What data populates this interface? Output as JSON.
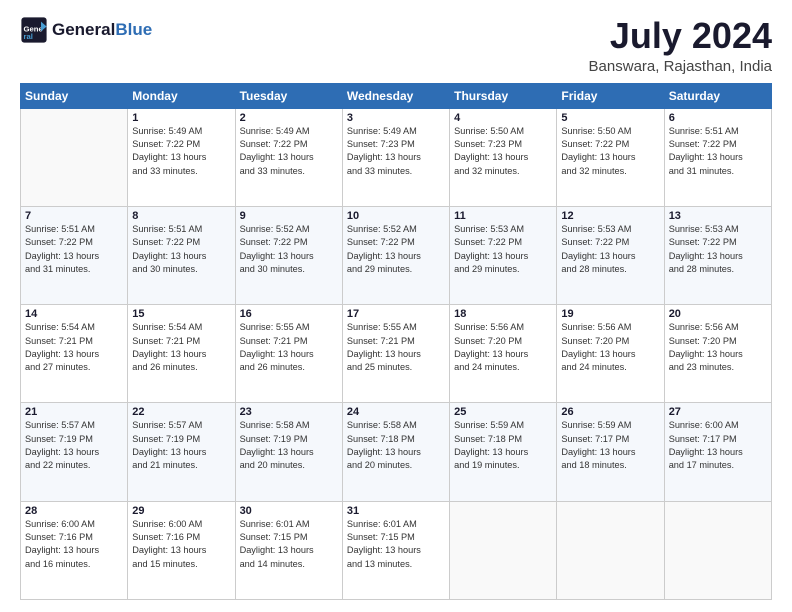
{
  "logo": {
    "line1": "General",
    "line2": "Blue"
  },
  "title": "July 2024",
  "location": "Banswara, Rajasthan, India",
  "days_header": [
    "Sunday",
    "Monday",
    "Tuesday",
    "Wednesday",
    "Thursday",
    "Friday",
    "Saturday"
  ],
  "weeks": [
    [
      {
        "day": "",
        "info": ""
      },
      {
        "day": "1",
        "info": "Sunrise: 5:49 AM\nSunset: 7:22 PM\nDaylight: 13 hours\nand 33 minutes."
      },
      {
        "day": "2",
        "info": "Sunrise: 5:49 AM\nSunset: 7:22 PM\nDaylight: 13 hours\nand 33 minutes."
      },
      {
        "day": "3",
        "info": "Sunrise: 5:49 AM\nSunset: 7:23 PM\nDaylight: 13 hours\nand 33 minutes."
      },
      {
        "day": "4",
        "info": "Sunrise: 5:50 AM\nSunset: 7:23 PM\nDaylight: 13 hours\nand 32 minutes."
      },
      {
        "day": "5",
        "info": "Sunrise: 5:50 AM\nSunset: 7:22 PM\nDaylight: 13 hours\nand 32 minutes."
      },
      {
        "day": "6",
        "info": "Sunrise: 5:51 AM\nSunset: 7:22 PM\nDaylight: 13 hours\nand 31 minutes."
      }
    ],
    [
      {
        "day": "7",
        "info": "Sunrise: 5:51 AM\nSunset: 7:22 PM\nDaylight: 13 hours\nand 31 minutes."
      },
      {
        "day": "8",
        "info": "Sunrise: 5:51 AM\nSunset: 7:22 PM\nDaylight: 13 hours\nand 30 minutes."
      },
      {
        "day": "9",
        "info": "Sunrise: 5:52 AM\nSunset: 7:22 PM\nDaylight: 13 hours\nand 30 minutes."
      },
      {
        "day": "10",
        "info": "Sunrise: 5:52 AM\nSunset: 7:22 PM\nDaylight: 13 hours\nand 29 minutes."
      },
      {
        "day": "11",
        "info": "Sunrise: 5:53 AM\nSunset: 7:22 PM\nDaylight: 13 hours\nand 29 minutes."
      },
      {
        "day": "12",
        "info": "Sunrise: 5:53 AM\nSunset: 7:22 PM\nDaylight: 13 hours\nand 28 minutes."
      },
      {
        "day": "13",
        "info": "Sunrise: 5:53 AM\nSunset: 7:22 PM\nDaylight: 13 hours\nand 28 minutes."
      }
    ],
    [
      {
        "day": "14",
        "info": "Sunrise: 5:54 AM\nSunset: 7:21 PM\nDaylight: 13 hours\nand 27 minutes."
      },
      {
        "day": "15",
        "info": "Sunrise: 5:54 AM\nSunset: 7:21 PM\nDaylight: 13 hours\nand 26 minutes."
      },
      {
        "day": "16",
        "info": "Sunrise: 5:55 AM\nSunset: 7:21 PM\nDaylight: 13 hours\nand 26 minutes."
      },
      {
        "day": "17",
        "info": "Sunrise: 5:55 AM\nSunset: 7:21 PM\nDaylight: 13 hours\nand 25 minutes."
      },
      {
        "day": "18",
        "info": "Sunrise: 5:56 AM\nSunset: 7:20 PM\nDaylight: 13 hours\nand 24 minutes."
      },
      {
        "day": "19",
        "info": "Sunrise: 5:56 AM\nSunset: 7:20 PM\nDaylight: 13 hours\nand 24 minutes."
      },
      {
        "day": "20",
        "info": "Sunrise: 5:56 AM\nSunset: 7:20 PM\nDaylight: 13 hours\nand 23 minutes."
      }
    ],
    [
      {
        "day": "21",
        "info": "Sunrise: 5:57 AM\nSunset: 7:19 PM\nDaylight: 13 hours\nand 22 minutes."
      },
      {
        "day": "22",
        "info": "Sunrise: 5:57 AM\nSunset: 7:19 PM\nDaylight: 13 hours\nand 21 minutes."
      },
      {
        "day": "23",
        "info": "Sunrise: 5:58 AM\nSunset: 7:19 PM\nDaylight: 13 hours\nand 20 minutes."
      },
      {
        "day": "24",
        "info": "Sunrise: 5:58 AM\nSunset: 7:18 PM\nDaylight: 13 hours\nand 20 minutes."
      },
      {
        "day": "25",
        "info": "Sunrise: 5:59 AM\nSunset: 7:18 PM\nDaylight: 13 hours\nand 19 minutes."
      },
      {
        "day": "26",
        "info": "Sunrise: 5:59 AM\nSunset: 7:17 PM\nDaylight: 13 hours\nand 18 minutes."
      },
      {
        "day": "27",
        "info": "Sunrise: 6:00 AM\nSunset: 7:17 PM\nDaylight: 13 hours\nand 17 minutes."
      }
    ],
    [
      {
        "day": "28",
        "info": "Sunrise: 6:00 AM\nSunset: 7:16 PM\nDaylight: 13 hours\nand 16 minutes."
      },
      {
        "day": "29",
        "info": "Sunrise: 6:00 AM\nSunset: 7:16 PM\nDaylight: 13 hours\nand 15 minutes."
      },
      {
        "day": "30",
        "info": "Sunrise: 6:01 AM\nSunset: 7:15 PM\nDaylight: 13 hours\nand 14 minutes."
      },
      {
        "day": "31",
        "info": "Sunrise: 6:01 AM\nSunset: 7:15 PM\nDaylight: 13 hours\nand 13 minutes."
      },
      {
        "day": "",
        "info": ""
      },
      {
        "day": "",
        "info": ""
      },
      {
        "day": "",
        "info": ""
      }
    ]
  ]
}
